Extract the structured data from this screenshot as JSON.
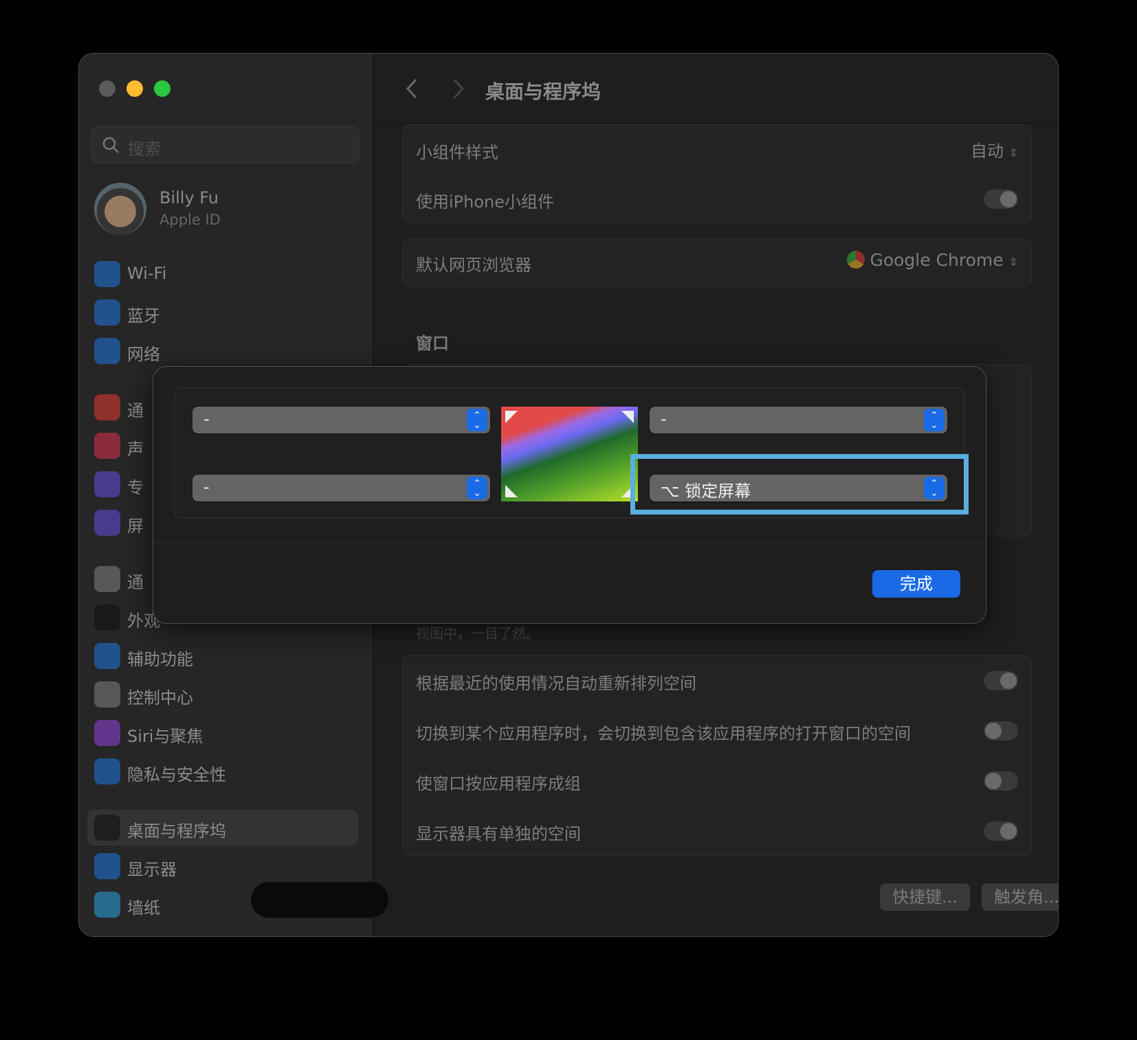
{
  "window": {
    "title": "桌面与程序坞"
  },
  "sidebar": {
    "search_placeholder": "搜索",
    "profile": {
      "name": "Billy Fu",
      "subtitle": "Apple ID"
    },
    "items": [
      {
        "label": "Wi-Fi",
        "icon": "wifi-icon",
        "color": "#1f6fd1"
      },
      {
        "label": "蓝牙",
        "icon": "bluetooth-icon",
        "color": "#1f6fd1"
      },
      {
        "label": "网络",
        "icon": "globe-icon",
        "color": "#1f6fd1"
      },
      {
        "label": "通",
        "icon": "bell-icon",
        "color": "#d6372f"
      },
      {
        "label": "声",
        "icon": "speaker-icon",
        "color": "#d0304a"
      },
      {
        "label": "专",
        "icon": "moon-icon",
        "color": "#5b4ad0"
      },
      {
        "label": "屏",
        "icon": "hourglass-icon",
        "color": "#5b4ad0"
      },
      {
        "label": "通",
        "icon": "gear-icon",
        "color": "#7a7a7a"
      },
      {
        "label": "外观",
        "icon": "appearance-icon",
        "color": "#111111"
      },
      {
        "label": "辅助功能",
        "icon": "accessibility-icon",
        "color": "#1f6fd1"
      },
      {
        "label": "控制中心",
        "icon": "control-center-icon",
        "color": "#7a7a7a"
      },
      {
        "label": "Siri与聚焦",
        "icon": "siri-icon",
        "color": "#8a3fd0"
      },
      {
        "label": "隐私与安全性",
        "icon": "hand-icon",
        "color": "#1f6fd1"
      },
      {
        "label": "桌面与程序坞",
        "icon": "dock-icon",
        "color": "#111111"
      },
      {
        "label": "显示器",
        "icon": "sun-icon",
        "color": "#1f6fd1"
      },
      {
        "label": "墙纸",
        "icon": "flower-icon",
        "color": "#2a9ad0"
      }
    ],
    "selected": "桌面与程序坞"
  },
  "main": {
    "widgets": {
      "style_label": "小组件样式",
      "style_value": "自动",
      "iphone_label": "使用iPhone小组件",
      "iphone_on": true
    },
    "browser": {
      "label": "默认网页浏览器",
      "value": "Google Chrome"
    },
    "windows_header": "窗口",
    "faded_text": "视图中，一目了然。",
    "spaces": [
      {
        "label": "根据最近的使用情况自动重新排列空间",
        "on": true
      },
      {
        "label": "切换到某个应用程序时，会切换到包含该应用程序的打开窗口的空间",
        "on": false
      },
      {
        "label": "使窗口按应用程序成组",
        "on": false
      },
      {
        "label": "显示器具有单独的空间",
        "on": true
      }
    ],
    "shortcuts_button": "快捷键...",
    "hot_corners_button": "触发角...",
    "help_button": "?"
  },
  "dialog": {
    "top_left": "-",
    "bottom_left": "-",
    "top_right": "-",
    "bottom_right": "⌥ 锁定屏幕",
    "done_button": "完成",
    "accent": "#1a6ae6",
    "highlight": "#5aaee0"
  }
}
